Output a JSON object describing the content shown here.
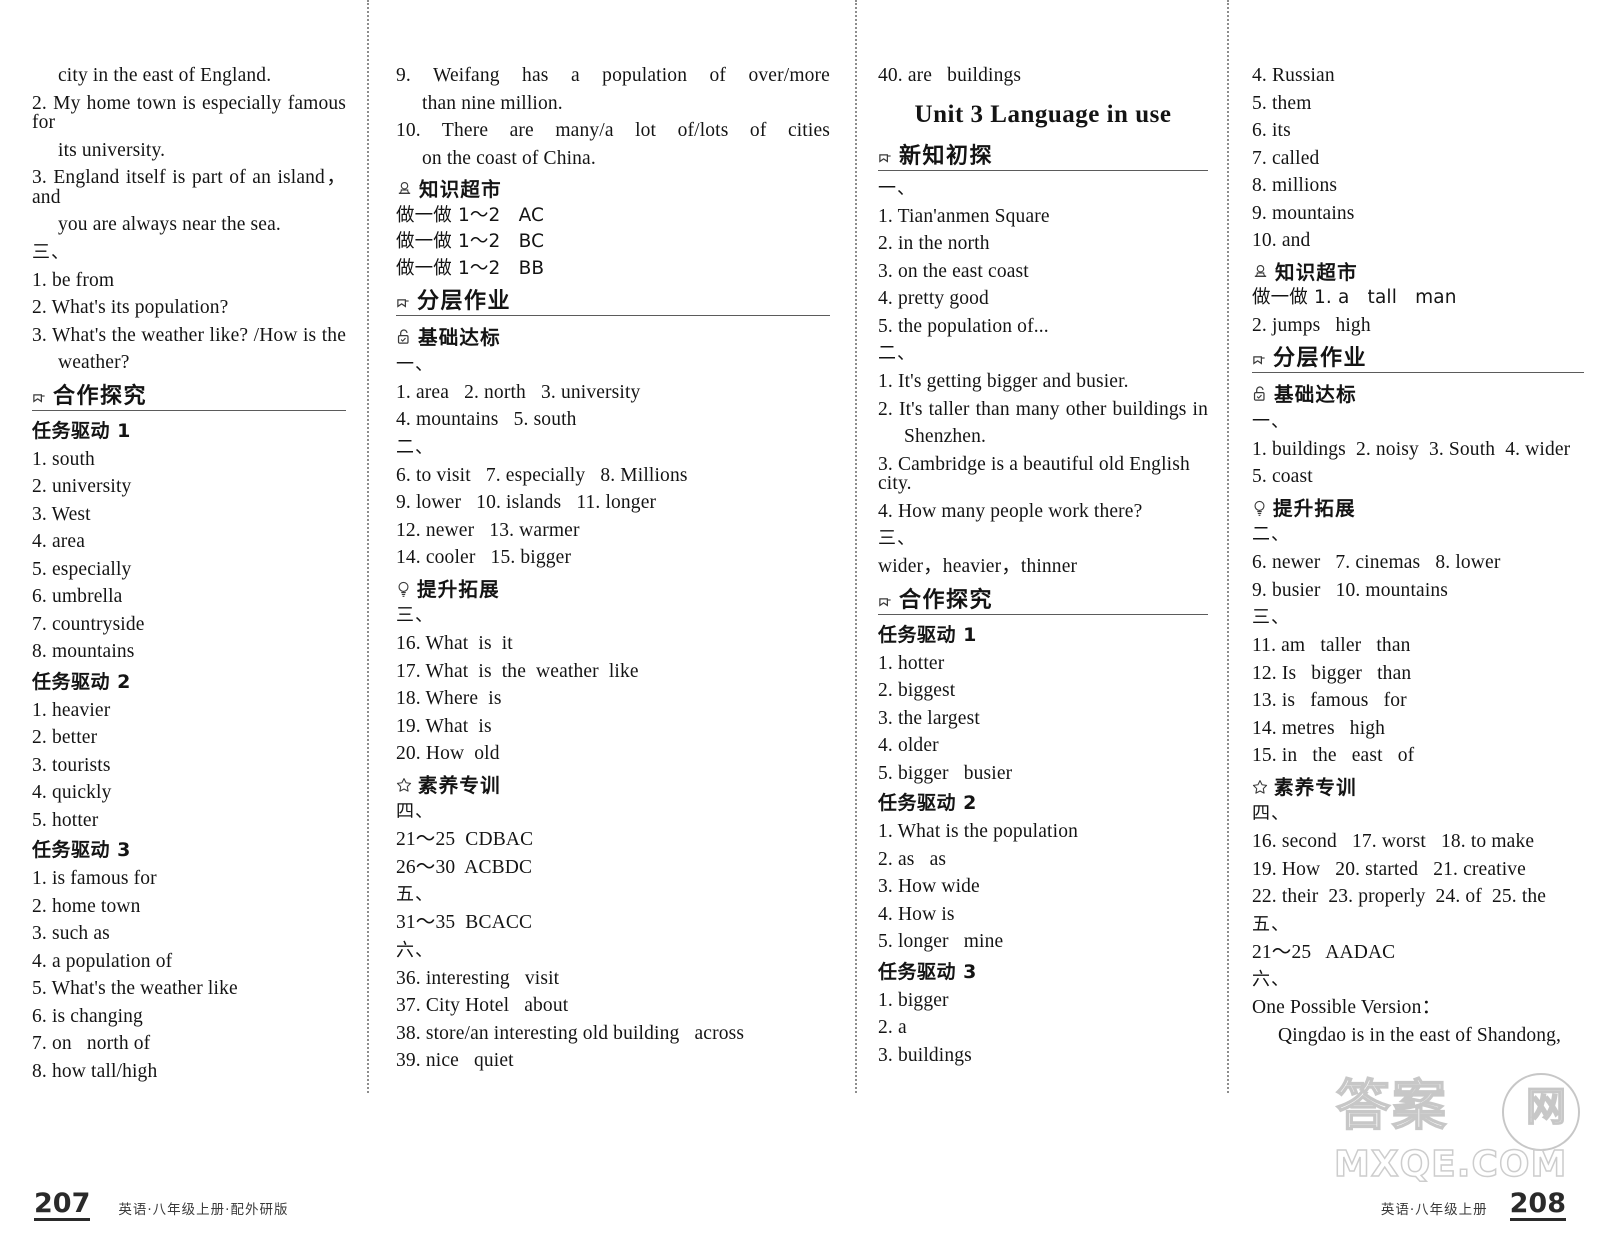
{
  "page": {
    "left_page_number": "207",
    "right_page_number": "208",
    "left_footer_note": "英语·八年级上册·配外研版",
    "right_footer_note": "英语·八年级上册",
    "watermark": {
      "cn": "答案",
      "circle": "网",
      "url": "MXQE.COM"
    }
  },
  "icons": {
    "ribbon": "ribbon-icon",
    "stamp": "stamp-icon",
    "lock": "lock-icon",
    "bulb": "bulb-icon",
    "star": "star-icon"
  },
  "columns": [
    {
      "id": "column-1",
      "blocks": [
        {
          "type": "line",
          "indent": true,
          "text": "city in the east of England."
        },
        {
          "type": "line",
          "justify": true,
          "text": "2. My home town is especially famous for"
        },
        {
          "type": "line",
          "indent": true,
          "text": "its university."
        },
        {
          "type": "line",
          "justify": true,
          "text": "3. England itself is part of an island，and"
        },
        {
          "type": "line",
          "indent": true,
          "text": "you are always near the sea."
        },
        {
          "type": "cnum",
          "text": "三、"
        },
        {
          "type": "line",
          "text": "1. be from"
        },
        {
          "type": "line",
          "text": "2. What's its population?"
        },
        {
          "type": "line",
          "justify": true,
          "text": "3. What's the weather like? /How is the"
        },
        {
          "type": "line",
          "indent": true,
          "text": "weather?"
        },
        {
          "type": "banner",
          "icon": "ribbon",
          "text": "合作探究"
        },
        {
          "type": "taskhead",
          "text": "任务驱动 1"
        },
        {
          "type": "line",
          "text": "1. south"
        },
        {
          "type": "line",
          "text": "2. university"
        },
        {
          "type": "line",
          "text": "3. West"
        },
        {
          "type": "line",
          "text": "4. area"
        },
        {
          "type": "line",
          "text": "5. especially"
        },
        {
          "type": "line",
          "text": "6. umbrella"
        },
        {
          "type": "line",
          "text": "7. countryside"
        },
        {
          "type": "line",
          "text": "8. mountains"
        },
        {
          "type": "taskhead",
          "text": "任务驱动 2"
        },
        {
          "type": "line",
          "text": "1. heavier"
        },
        {
          "type": "line",
          "text": "2. better"
        },
        {
          "type": "line",
          "text": "3. tourists"
        },
        {
          "type": "line",
          "text": "4. quickly"
        },
        {
          "type": "line",
          "text": "5. hotter"
        },
        {
          "type": "taskhead",
          "text": "任务驱动 3"
        },
        {
          "type": "line",
          "text": "1. is famous for"
        },
        {
          "type": "line",
          "text": "2. home town"
        },
        {
          "type": "line",
          "text": "3. such as"
        },
        {
          "type": "line",
          "text": "4. a population of"
        },
        {
          "type": "line",
          "text": "5. What's the weather like"
        },
        {
          "type": "line",
          "text": "6. is changing"
        },
        {
          "type": "line",
          "text": "7. on   north of"
        },
        {
          "type": "line",
          "text": "8. how tall/high"
        }
      ]
    },
    {
      "id": "column-2",
      "blocks": [
        {
          "type": "line",
          "justify": true,
          "text": "9. Weifang has a population of over/more"
        },
        {
          "type": "line",
          "indent": true,
          "text": "than nine million."
        },
        {
          "type": "line",
          "justify": true,
          "text": "10. There are many/a lot of/lots of cities"
        },
        {
          "type": "line",
          "indent": true,
          "text": "on the coast of China."
        },
        {
          "type": "subhead",
          "icon": "stamp",
          "text": "知识超市"
        },
        {
          "type": "line",
          "cn": true,
          "text": "做一做 1～2   AC"
        },
        {
          "type": "line",
          "cn": true,
          "text": "做一做 1～2   BC"
        },
        {
          "type": "line",
          "cn": true,
          "text": "做一做 1～2   BB"
        },
        {
          "type": "banner",
          "icon": "ribbon",
          "text": "分层作业"
        },
        {
          "type": "subhead",
          "icon": "lock",
          "text": "基础达标"
        },
        {
          "type": "cnum",
          "text": "一、"
        },
        {
          "type": "line",
          "text": "1. area   2. north   3. university"
        },
        {
          "type": "line",
          "text": "4. mountains   5. south"
        },
        {
          "type": "cnum",
          "text": "二、"
        },
        {
          "type": "line",
          "text": "6. to visit   7. especially   8. Millions"
        },
        {
          "type": "line",
          "text": "9. lower   10. islands   11. longer"
        },
        {
          "type": "line",
          "text": "12. newer   13. warmer"
        },
        {
          "type": "line",
          "text": "14. cooler   15. bigger"
        },
        {
          "type": "subhead",
          "icon": "bulb",
          "text": "提升拓展"
        },
        {
          "type": "cnum",
          "text": "三、"
        },
        {
          "type": "line",
          "text": "16. What  is  it"
        },
        {
          "type": "line",
          "text": "17. What  is  the  weather  like"
        },
        {
          "type": "line",
          "text": "18. Where  is"
        },
        {
          "type": "line",
          "text": "19. What  is"
        },
        {
          "type": "line",
          "text": "20. How  old"
        },
        {
          "type": "subhead",
          "icon": "star",
          "text": "素养专训"
        },
        {
          "type": "cnum",
          "text": "四、"
        },
        {
          "type": "line",
          "text": "21～25  CDBAC"
        },
        {
          "type": "line",
          "text": "26～30  ACBDC"
        },
        {
          "type": "cnum",
          "text": "五、"
        },
        {
          "type": "line",
          "text": "31～35  BCACC"
        },
        {
          "type": "cnum",
          "text": "六、"
        },
        {
          "type": "line",
          "text": "36. interesting   visit"
        },
        {
          "type": "line",
          "text": "37. City Hotel   about"
        },
        {
          "type": "line",
          "text": "38. store/an interesting old building   across"
        },
        {
          "type": "line",
          "text": "39. nice   quiet"
        }
      ]
    },
    {
      "id": "column-3",
      "blocks": [
        {
          "type": "line",
          "text": "40. are   buildings"
        },
        {
          "type": "unit-title",
          "text": "Unit 3   Language in use"
        },
        {
          "type": "banner",
          "icon": "ribbon",
          "text": "新知初探"
        },
        {
          "type": "cnum",
          "text": "一、"
        },
        {
          "type": "line",
          "text": "1. Tian'anmen Square"
        },
        {
          "type": "line",
          "text": "2. in the north"
        },
        {
          "type": "line",
          "text": "3. on the east coast"
        },
        {
          "type": "line",
          "text": "4. pretty good"
        },
        {
          "type": "line",
          "text": "5. the population of..."
        },
        {
          "type": "cnum",
          "text": "二、"
        },
        {
          "type": "line",
          "text": "1. It's getting bigger and busier."
        },
        {
          "type": "line",
          "justify": true,
          "text": "2. It's taller than many other buildings in"
        },
        {
          "type": "line",
          "indent": true,
          "text": "Shenzhen."
        },
        {
          "type": "line",
          "text": "3. Cambridge is a beautiful old English city."
        },
        {
          "type": "line",
          "text": "4. How many people work there?"
        },
        {
          "type": "cnum",
          "text": "三、"
        },
        {
          "type": "line",
          "text": "wider，heavier，thinner"
        },
        {
          "type": "banner",
          "icon": "ribbon",
          "text": "合作探究"
        },
        {
          "type": "taskhead",
          "text": "任务驱动 1"
        },
        {
          "type": "line",
          "text": "1. hotter"
        },
        {
          "type": "line",
          "text": "2. biggest"
        },
        {
          "type": "line",
          "text": "3. the largest"
        },
        {
          "type": "line",
          "text": "4. older"
        },
        {
          "type": "line",
          "text": "5. bigger   busier"
        },
        {
          "type": "taskhead",
          "text": "任务驱动 2"
        },
        {
          "type": "line",
          "text": "1. What is the population"
        },
        {
          "type": "line",
          "text": "2. as   as"
        },
        {
          "type": "line",
          "text": "3. How wide"
        },
        {
          "type": "line",
          "text": "4. How is"
        },
        {
          "type": "line",
          "text": "5. longer   mine"
        },
        {
          "type": "taskhead",
          "text": "任务驱动 3"
        },
        {
          "type": "line",
          "text": "1. bigger"
        },
        {
          "type": "line",
          "text": "2. a"
        },
        {
          "type": "line",
          "text": "3. buildings"
        }
      ]
    },
    {
      "id": "column-4",
      "blocks": [
        {
          "type": "line",
          "text": "4. Russian"
        },
        {
          "type": "line",
          "text": "5. them"
        },
        {
          "type": "line",
          "text": "6. its"
        },
        {
          "type": "line",
          "text": "7. called"
        },
        {
          "type": "line",
          "text": "8. millions"
        },
        {
          "type": "line",
          "text": "9. mountains"
        },
        {
          "type": "line",
          "text": "10. and"
        },
        {
          "type": "subhead",
          "icon": "stamp",
          "text": "知识超市"
        },
        {
          "type": "line",
          "cn": true,
          "text": "做一做 1. a   tall   man"
        },
        {
          "type": "line",
          "text": "2. jumps   high"
        },
        {
          "type": "banner",
          "icon": "ribbon",
          "text": "分层作业"
        },
        {
          "type": "subhead",
          "icon": "lock",
          "text": "基础达标"
        },
        {
          "type": "cnum",
          "text": "一、"
        },
        {
          "type": "line",
          "text": "1. buildings  2. noisy  3. South  4. wider"
        },
        {
          "type": "line",
          "text": "5. coast"
        },
        {
          "type": "subhead",
          "icon": "bulb",
          "text": "提升拓展"
        },
        {
          "type": "cnum",
          "text": "二、"
        },
        {
          "type": "line",
          "text": "6. newer   7. cinemas   8. lower"
        },
        {
          "type": "line",
          "text": "9. busier   10. mountains"
        },
        {
          "type": "cnum",
          "text": "三、"
        },
        {
          "type": "line",
          "text": "11. am   taller   than"
        },
        {
          "type": "line",
          "text": "12. Is   bigger   than"
        },
        {
          "type": "line",
          "text": "13. is   famous   for"
        },
        {
          "type": "line",
          "text": "14. metres   high"
        },
        {
          "type": "line",
          "text": "15. in   the   east   of"
        },
        {
          "type": "subhead",
          "icon": "star",
          "text": "素养专训"
        },
        {
          "type": "cnum",
          "text": "四、"
        },
        {
          "type": "line",
          "text": "16. second   17. worst   18. to make"
        },
        {
          "type": "line",
          "text": "19. How   20. started   21. creative"
        },
        {
          "type": "line",
          "text": "22. their  23. properly  24. of  25. the"
        },
        {
          "type": "cnum",
          "text": "五、"
        },
        {
          "type": "line",
          "text": "21～25   AADAC"
        },
        {
          "type": "cnum",
          "text": "六、"
        },
        {
          "type": "line",
          "text": "One Possible Version："
        },
        {
          "type": "line",
          "indent": true,
          "text": "Qingdao is in the east of Shandong,"
        }
      ]
    }
  ]
}
